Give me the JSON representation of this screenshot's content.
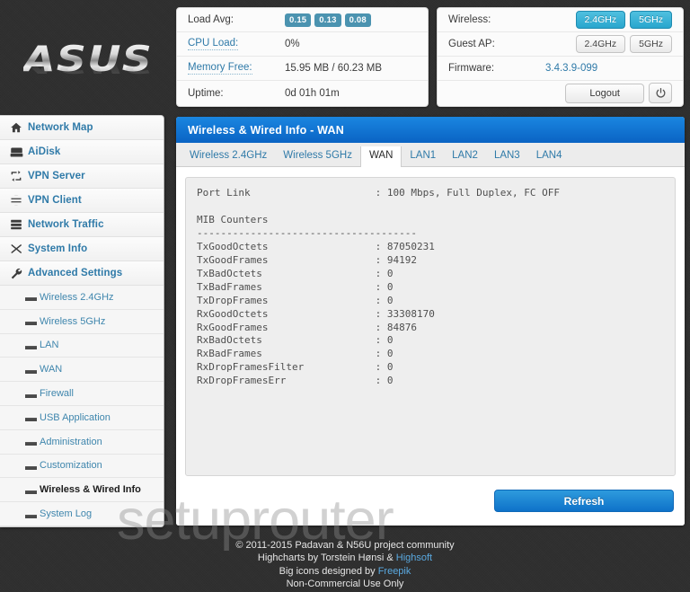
{
  "brand": {
    "logo_text": "ASUS"
  },
  "system_panel": {
    "rows": [
      {
        "label": "Load Avg:",
        "is_link": false,
        "type": "badges",
        "badges": [
          "0.15",
          "0.13",
          "0.08"
        ]
      },
      {
        "label": "CPU Load:",
        "is_link": true,
        "type": "text",
        "value": "0%"
      },
      {
        "label": "Memory Free:",
        "is_link": true,
        "type": "text",
        "value": "15.95 MB / 60.23 MB"
      },
      {
        "label": "Uptime:",
        "is_link": false,
        "type": "text",
        "value": "0d 01h 01m"
      }
    ]
  },
  "wireless_panel": {
    "wireless_label": "Wireless:",
    "wireless_buttons": [
      {
        "label": "2.4GHz",
        "active": true
      },
      {
        "label": "5GHz",
        "active": true
      }
    ],
    "guest_label": "Guest AP:",
    "guest_buttons": [
      {
        "label": "2.4GHz",
        "active": false
      },
      {
        "label": "5GHz",
        "active": false
      }
    ],
    "firmware_label": "Firmware:",
    "firmware_value": "3.4.3.9-099",
    "logout_label": "Logout",
    "power_icon": "power-icon"
  },
  "sidebar": {
    "items": [
      {
        "label": "Network Map",
        "icon": "home-icon"
      },
      {
        "label": "AiDisk",
        "icon": "hard-drive-icon"
      },
      {
        "label": "VPN Server",
        "icon": "vpn-server-icon"
      },
      {
        "label": "VPN Client",
        "icon": "globe-icon"
      },
      {
        "label": "Network Traffic",
        "icon": "network-traffic-icon"
      },
      {
        "label": "System Info",
        "icon": "shuffle-icon"
      },
      {
        "label": "Advanced Settings",
        "icon": "wrench-icon"
      }
    ],
    "sub_items": [
      {
        "label": "Wireless 2.4GHz",
        "active": false
      },
      {
        "label": "Wireless 5GHz",
        "active": false
      },
      {
        "label": "LAN",
        "active": false
      },
      {
        "label": "WAN",
        "active": false
      },
      {
        "label": "Firewall",
        "active": false
      },
      {
        "label": "USB Application",
        "active": false
      },
      {
        "label": "Administration",
        "active": false
      },
      {
        "label": "Customization",
        "active": false
      },
      {
        "label": "Wireless & Wired Info",
        "active": true
      },
      {
        "label": "System Log",
        "active": false
      }
    ]
  },
  "content": {
    "title": "Wireless & Wired Info - WAN",
    "tabs": [
      {
        "label": "Wireless 2.4GHz",
        "active": false
      },
      {
        "label": "Wireless 5GHz",
        "active": false
      },
      {
        "label": "WAN",
        "active": true
      },
      {
        "label": "LAN1",
        "active": false
      },
      {
        "label": "LAN2",
        "active": false
      },
      {
        "label": "LAN3",
        "active": false
      },
      {
        "label": "LAN4",
        "active": false
      }
    ],
    "console_text": "Port Link                     : 100 Mbps, Full Duplex, FC OFF\n\nMIB Counters\n-------------------------------------\nTxGoodOctets                  : 87050231\nTxGoodFrames                  : 94192\nTxBadOctets                   : 0\nTxBadFrames                   : 0\nTxDropFrames                  : 0\nRxGoodOctets                  : 33308170\nRxGoodFrames                  : 84876\nRxBadOctets                   : 0\nRxBadFrames                   : 0\nRxDropFramesFilter            : 0\nRxDropFramesErr               : 0",
    "refresh_label": "Refresh"
  },
  "watermark": {
    "text": "setuprouter"
  },
  "footer": {
    "line1": "© 2011-2015 Padavan & N56U project community",
    "line2_prefix": "Highcharts by Torstein Hønsi & ",
    "line2_link": "Highsoft",
    "line3_prefix": "Big icons designed by ",
    "line3_link": "Freepik",
    "line4": "Non-Commercial Use Only"
  },
  "colors": {
    "accent_blue": "#2f7aa8",
    "title_bar": "#0a63c4",
    "badge_teal": "#4b93b0",
    "active_ghz": "#29a6ce",
    "refresh_button": "#0e72c9"
  }
}
